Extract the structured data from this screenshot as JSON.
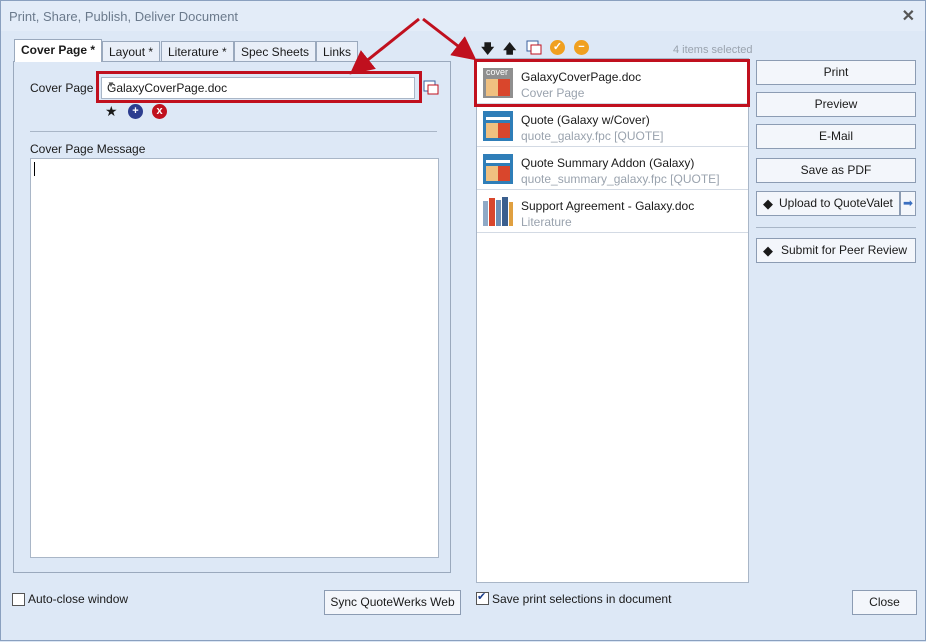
{
  "window": {
    "title": "Print, Share, Publish, Deliver Document"
  },
  "tabs": [
    {
      "label": "Cover Page *"
    },
    {
      "label": "Layout *"
    },
    {
      "label": "Literature *"
    },
    {
      "label": "Spec Sheets"
    },
    {
      "label": "Links"
    }
  ],
  "cover": {
    "cover_page_label": "Cover Page",
    "selected_value": "GalaxyCoverPage.doc",
    "message_label": "Cover Page Message",
    "message_value": ""
  },
  "list": {
    "selected_count": "4 items selected",
    "items": [
      {
        "name": "GalaxyCoverPage.doc",
        "sub": "Cover Page"
      },
      {
        "name": "Quote (Galaxy w/Cover)",
        "sub": "quote_galaxy.fpc [QUOTE]"
      },
      {
        "name": "Quote Summary Addon (Galaxy)",
        "sub": "quote_summary_galaxy.fpc [QUOTE]"
      },
      {
        "name": "Support Agreement - Galaxy.doc",
        "sub": "Literature"
      }
    ]
  },
  "buttons": {
    "print": "Print",
    "preview": "Preview",
    "email": "E-Mail",
    "save_pdf": "Save as PDF",
    "upload": "Upload to QuoteValet",
    "peer_review": "Submit for Peer Review",
    "sync": "Sync QuoteWerks Web",
    "close": "Close"
  },
  "footer": {
    "auto_close": "Auto-close window",
    "save_print": "Save print selections in document"
  },
  "colors": {
    "highlight": "#c0101e",
    "accent": "#f0a020"
  },
  "icons": [
    "close-icon",
    "folder-icon",
    "star-icon",
    "add-icon",
    "remove-icon",
    "move-down-icon",
    "move-up-icon",
    "check-circle-icon",
    "minus-circle-icon",
    "upload-arrow-icon"
  ]
}
